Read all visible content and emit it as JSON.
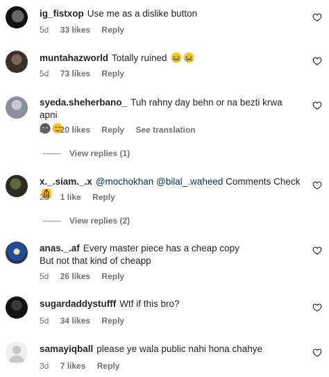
{
  "comments": [
    {
      "user": "ig_fistxop",
      "text": "Use me as a dislike button",
      "time": "5d",
      "likes": "33 likes",
      "reply": "Reply"
    },
    {
      "user": "muntahazworld",
      "text": "Totally ruined",
      "time": "5d",
      "likes": "73 likes",
      "reply": "Reply"
    },
    {
      "user": "syeda.sheherbano_",
      "text": "Tuh rahny day behn or na bezti krwa apni",
      "time": "5d",
      "likes": "20 likes",
      "reply": "Reply",
      "see_translation": "See translation",
      "view_replies": "View replies (1)"
    },
    {
      "user": "x._.siam._.x",
      "mention1": "@mochokhan",
      "mention2": "@bilal_.waheed",
      "text": "Comments Check",
      "time": "2d",
      "likes": "1 like",
      "reply": "Reply",
      "view_replies": "View replies (2)"
    },
    {
      "user": "anas._.af",
      "text": "Every master piece has a cheap copy",
      "text2": "But not that kind of cheapp",
      "time": "5d",
      "likes": "26 likes",
      "reply": "Reply"
    },
    {
      "user": "sugardaddystufff",
      "text": "Wtf if this bro?",
      "time": "5d",
      "likes": "34 likes",
      "reply": "Reply"
    },
    {
      "user": "samayiqball",
      "text": "please ye wala public nahi hona chahye",
      "time": "3d",
      "likes": "7 likes",
      "reply": "Reply"
    }
  ],
  "icons": {
    "like": "heart-outline-icon",
    "emoji_crying": "crying-face-emoji",
    "emoji_unamused": "unamused-face-emoji",
    "emoji_pray": "folded-hands-emoji"
  }
}
